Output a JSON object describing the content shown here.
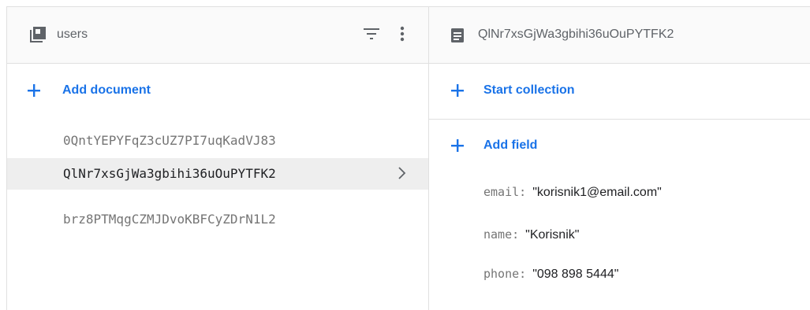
{
  "collection_panel": {
    "title": "users",
    "icons": {
      "collection": "collection-icon",
      "filter": "filter-icon",
      "more": "more-vert-icon"
    },
    "add_label": "Add document",
    "documents": [
      {
        "id": "0QntYEPYFqZ3cUZ7PI7uqKadVJ83",
        "selected": false
      },
      {
        "id": "QlNr7xsGjWa3gbihi36uOuPYTFK2",
        "selected": true
      },
      {
        "id": "brz8PTMqgCZMJDvoKBFCyZDrN1L2",
        "selected": false
      }
    ]
  },
  "document_panel": {
    "title": "QlNr7xsGjWa3gbihi36uOuPYTFK2",
    "icons": {
      "document": "document-icon"
    },
    "start_collection_label": "Start collection",
    "add_field_label": "Add field",
    "fields": [
      {
        "key": "email",
        "value": "\"korisnik1@email.com\""
      },
      {
        "key": "name",
        "value": "\"Korisnik\""
      },
      {
        "key": "phone",
        "value": "\"098 898 5444\""
      }
    ]
  },
  "colors": {
    "accent": "#1a73e8",
    "selected_row": "#eeeeee",
    "muted_text": "#757575",
    "header_bg": "#fafafa"
  }
}
